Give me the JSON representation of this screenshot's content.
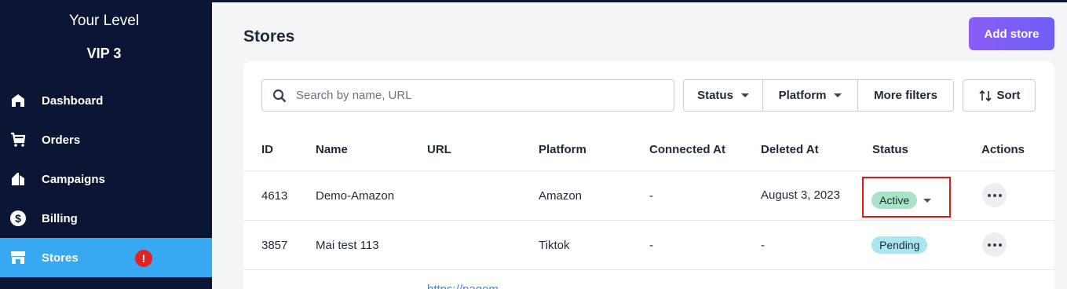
{
  "sidebar": {
    "level_title": "Your Level",
    "level_value": "VIP 3",
    "items": [
      {
        "label": "Dashboard",
        "icon": "home-icon"
      },
      {
        "label": "Orders",
        "icon": "cart-icon"
      },
      {
        "label": "Campaigns",
        "icon": "campaign-icon"
      },
      {
        "label": "Billing",
        "icon": "dollar-icon"
      },
      {
        "label": "Stores",
        "icon": "store-icon",
        "active": true,
        "badge": "!"
      }
    ]
  },
  "header": {
    "title": "Stores",
    "add_button": "Add store"
  },
  "search": {
    "placeholder": "Search by name, URL",
    "value": ""
  },
  "filters": {
    "status": "Status",
    "platform": "Platform",
    "more": "More filters",
    "sort": "Sort"
  },
  "table": {
    "columns": [
      "ID",
      "Name",
      "URL",
      "Platform",
      "Connected At",
      "Deleted At",
      "Status",
      "Actions"
    ],
    "rows": [
      {
        "id": "4613",
        "name": "Demo-Amazon",
        "url": "",
        "platform": "Amazon",
        "connected_at": "-",
        "deleted_at": "August 3, 2023",
        "status": "Active"
      },
      {
        "id": "3857",
        "name": "Mai test 113",
        "url": "",
        "platform": "Tiktok",
        "connected_at": "-",
        "deleted_at": "-",
        "status": "Pending"
      }
    ],
    "partial_url": "https://pagem"
  },
  "colors": {
    "sidebar_bg": "#0a1633",
    "active_nav": "#39a8f2",
    "accent": "#7c5cf6",
    "active_badge": "#a7e3c4",
    "pending_badge": "#a8e6f0",
    "highlight": "#e01b1b"
  }
}
